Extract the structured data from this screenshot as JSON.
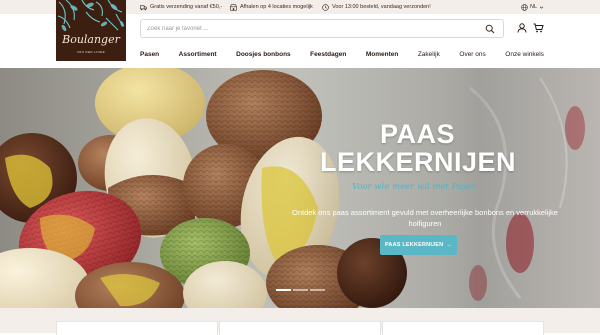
{
  "topbar": {
    "usps": [
      {
        "icon": "truck-icon",
        "text": "Gratis verzending vanaf €50,-"
      },
      {
        "icon": "store-icon",
        "text": "Afhalen op 4 locaties mogelijk"
      },
      {
        "icon": "clock-icon",
        "text": "Voor 13:00 besteld, vandaag verzonden!"
      }
    ],
    "language": "NL"
  },
  "logo": {
    "brand": "Boulanger",
    "tagline": "VAN DER LINDE"
  },
  "search": {
    "placeholder": "Zoek naar je favoriet ...",
    "value": ""
  },
  "nav": {
    "items": [
      {
        "label": "Pasen",
        "bold": true
      },
      {
        "label": "Assortiment",
        "bold": true
      },
      {
        "label": "Doosjes bonbons",
        "bold": true
      },
      {
        "label": "Feestdagen",
        "bold": true
      },
      {
        "label": "Momenten",
        "bold": true
      },
      {
        "label": "Zakelijk",
        "bold": false
      },
      {
        "label": "Over ons",
        "bold": false
      },
      {
        "label": "Onze winkels",
        "bold": false
      }
    ]
  },
  "hero": {
    "title_line1": "PAAS",
    "title_line2": "LEKKERNIJEN",
    "subtitle": "Voor wie meer wil met Pasen",
    "description": "Ontdek ons paas assortiment gevuld met overheerlijke bonbons en verrukkelijke holfiguren",
    "cta_label": "PAAS LEKKERNIJEN",
    "cta_arrow": "→",
    "slides": 3,
    "active_slide": 1
  },
  "colors": {
    "accent": "#5ab8c6",
    "logo_bg": "#3d1f12",
    "topbar_bg": "#f3eee9",
    "text_dark": "#2a1a14"
  }
}
